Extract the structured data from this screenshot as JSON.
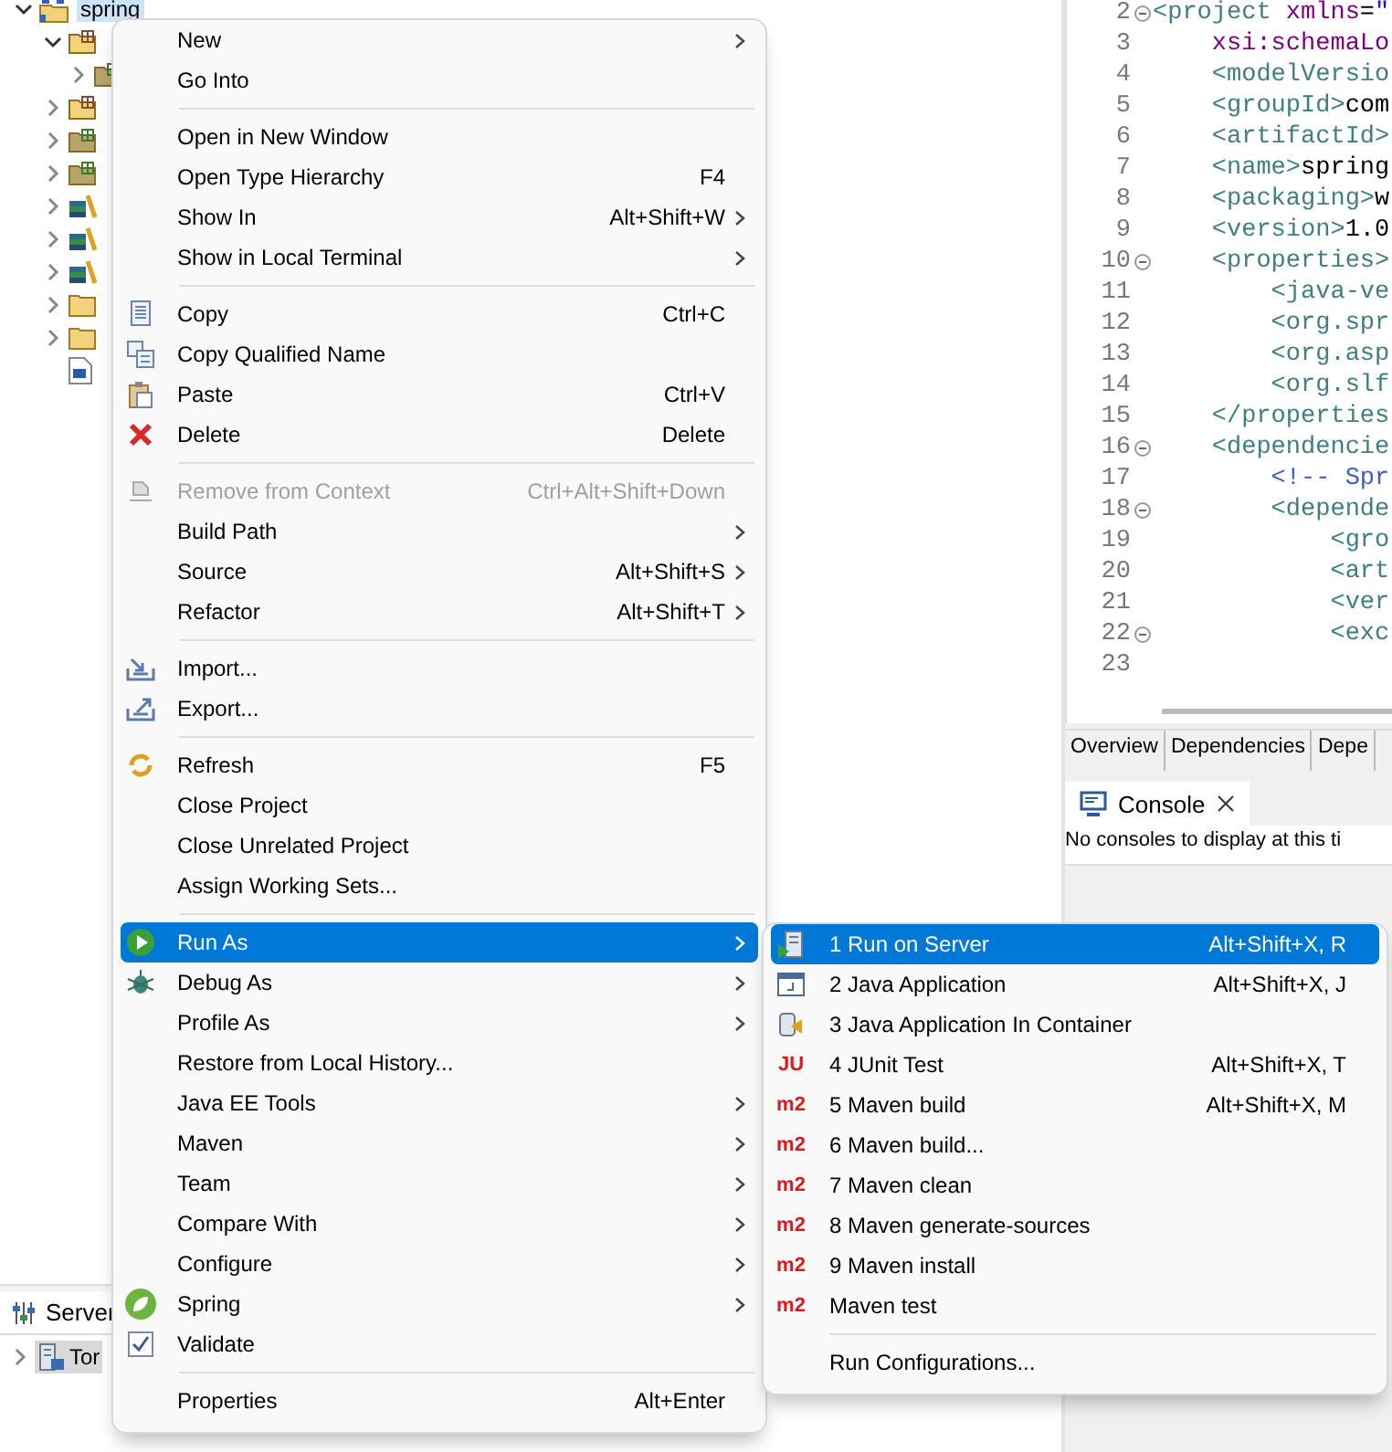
{
  "explorer": {
    "tree": [
      {
        "label": "spring",
        "kind": "project",
        "expanded": true,
        "selected": true,
        "children": [
          {
            "kind": "source",
            "expanded": true,
            "children": [
              {
                "kind": "package",
                "expanded": false
              }
            ]
          },
          {
            "kind": "source",
            "expanded": false
          },
          {
            "kind": "package",
            "expanded": false
          },
          {
            "kind": "package",
            "expanded": false
          },
          {
            "kind": "library",
            "expanded": false
          },
          {
            "kind": "library",
            "expanded": false
          },
          {
            "kind": "library",
            "expanded": false
          },
          {
            "kind": "folder",
            "expanded": false
          },
          {
            "kind": "folder",
            "expanded": false
          },
          {
            "kind": "pom"
          }
        ]
      }
    ]
  },
  "servers": {
    "tab": "Server",
    "rows": [
      {
        "label": "Tor",
        "expanded": false,
        "selected": true
      }
    ]
  },
  "editor": {
    "lines": [
      {
        "number": "2",
        "fold": true,
        "tokens": [
          {
            "kind": "tag",
            "text": "<project"
          },
          {
            "kind": "attr",
            "text": " xmlns"
          },
          {
            "kind": "text",
            "text": "="
          },
          {
            "kind": "value",
            "text": "\""
          }
        ]
      },
      {
        "number": "3",
        "fold": false,
        "tokens": [
          {
            "kind": "attr",
            "text": "    xsi:schemaLo"
          }
        ]
      },
      {
        "number": "4",
        "fold": false,
        "tokens": [
          {
            "kind": "tag",
            "text": "    <modelVersio"
          }
        ]
      },
      {
        "number": "5",
        "fold": false,
        "tokens": [
          {
            "kind": "tag",
            "text": "    <groupId>"
          },
          {
            "kind": "text",
            "text": "com"
          }
        ]
      },
      {
        "number": "6",
        "fold": false,
        "tokens": [
          {
            "kind": "tag",
            "text": "    <artifactId>"
          }
        ]
      },
      {
        "number": "7",
        "fold": false,
        "tokens": [
          {
            "kind": "tag",
            "text": "    <name>"
          },
          {
            "kind": "text",
            "text": "spring"
          }
        ]
      },
      {
        "number": "8",
        "fold": false,
        "tokens": [
          {
            "kind": "tag",
            "text": "    <packaging>"
          },
          {
            "kind": "text",
            "text": "w"
          }
        ]
      },
      {
        "number": "9",
        "fold": false,
        "tokens": [
          {
            "kind": "tag",
            "text": "    <version>"
          },
          {
            "kind": "text",
            "text": "1.0"
          }
        ]
      },
      {
        "number": "10",
        "fold": true,
        "tokens": [
          {
            "kind": "tag",
            "text": "    <properties>"
          }
        ]
      },
      {
        "number": "11",
        "fold": false,
        "tokens": [
          {
            "kind": "tag",
            "text": "        <java-ve"
          }
        ]
      },
      {
        "number": "12",
        "fold": false,
        "tokens": [
          {
            "kind": "tag",
            "text": "        <org.spr"
          }
        ]
      },
      {
        "number": "13",
        "fold": false,
        "tokens": [
          {
            "kind": "tag",
            "text": "        <org.asp"
          }
        ]
      },
      {
        "number": "14",
        "fold": false,
        "tokens": [
          {
            "kind": "tag",
            "text": "        <org.slf"
          }
        ]
      },
      {
        "number": "15",
        "fold": false,
        "tokens": [
          {
            "kind": "tag",
            "text": "    </properties"
          }
        ]
      },
      {
        "number": "16",
        "fold": true,
        "tokens": [
          {
            "kind": "tag",
            "text": "    <dependencie"
          }
        ]
      },
      {
        "number": "17",
        "fold": false,
        "tokens": [
          {
            "kind": "comment",
            "text": "        <!-- Spr"
          }
        ]
      },
      {
        "number": "18",
        "fold": true,
        "tokens": [
          {
            "kind": "tag",
            "text": "        <depende"
          }
        ]
      },
      {
        "number": "19",
        "fold": false,
        "tokens": [
          {
            "kind": "tag",
            "text": "            <gro"
          }
        ]
      },
      {
        "number": "20",
        "fold": false,
        "tokens": [
          {
            "kind": "tag",
            "text": "            <art"
          }
        ]
      },
      {
        "number": "21",
        "fold": false,
        "tokens": [
          {
            "kind": "tag",
            "text": "            <ver"
          }
        ]
      },
      {
        "number": "22",
        "fold": true,
        "tokens": [
          {
            "kind": "tag",
            "text": "            <exc"
          }
        ]
      },
      {
        "number": "23",
        "fold": false
      }
    ],
    "tabs": [
      "Overview",
      "Dependencies",
      "Depe"
    ]
  },
  "console": {
    "tab": "Console",
    "message": "No consoles to display at this ti"
  },
  "context_menu": {
    "groups": [
      {
        "items": [
          {
            "label": "New",
            "kind": "plain",
            "submenu": true,
            "selected": false,
            "disabled": false
          },
          {
            "label": "Go Into",
            "kind": "plain",
            "submenu": false,
            "selected": false,
            "disabled": false
          }
        ]
      },
      {
        "items": [
          {
            "label": "Open in New Window",
            "kind": "plain",
            "submenu": false,
            "selected": false,
            "disabled": false
          },
          {
            "label": "Open Type Hierarchy",
            "shortcut": "F4",
            "kind": "plain",
            "submenu": false,
            "selected": false,
            "disabled": false
          },
          {
            "label": "Show In",
            "shortcut": "Alt+Shift+W",
            "kind": "plain",
            "submenu": true,
            "selected": false,
            "disabled": false
          },
          {
            "label": "Show in Local Terminal",
            "kind": "plain",
            "submenu": true,
            "selected": false,
            "disabled": false
          }
        ]
      },
      {
        "items": [
          {
            "label": "Copy",
            "shortcut": "Ctrl+C",
            "kind": "copy",
            "submenu": false,
            "selected": false,
            "disabled": false
          },
          {
            "label": "Copy Qualified Name",
            "kind": "copyname",
            "submenu": false,
            "selected": false,
            "disabled": false
          },
          {
            "label": "Paste",
            "shortcut": "Ctrl+V",
            "kind": "paste",
            "submenu": false,
            "selected": false,
            "disabled": false
          },
          {
            "label": "Delete",
            "shortcut": "Delete",
            "kind": "delete",
            "submenu": false,
            "selected": false,
            "disabled": false
          }
        ]
      },
      {
        "items": [
          {
            "label": "Remove from Context",
            "shortcut": "Ctrl+Alt+Shift+Down",
            "kind": "remove",
            "submenu": false,
            "selected": false,
            "disabled": true
          },
          {
            "label": "Build Path",
            "kind": "plain",
            "submenu": true,
            "selected": false,
            "disabled": false
          },
          {
            "label": "Source",
            "shortcut": "Alt+Shift+S",
            "kind": "plain",
            "submenu": true,
            "selected": false,
            "disabled": false
          },
          {
            "label": "Refactor",
            "shortcut": "Alt+Shift+T",
            "kind": "plain",
            "submenu": true,
            "selected": false,
            "disabled": false
          }
        ]
      },
      {
        "items": [
          {
            "label": "Import...",
            "kind": "import",
            "submenu": false,
            "selected": false,
            "disabled": false
          },
          {
            "label": "Export...",
            "kind": "export",
            "submenu": false,
            "selected": false,
            "disabled": false
          }
        ]
      },
      {
        "items": [
          {
            "label": "Refresh",
            "shortcut": "F5",
            "kind": "refresh",
            "submenu": false,
            "selected": false,
            "disabled": false
          },
          {
            "label": "Close Project",
            "kind": "plain",
            "submenu": false,
            "selected": false,
            "disabled": false
          },
          {
            "label": "Close Unrelated Project",
            "kind": "plain",
            "submenu": false,
            "selected": false,
            "disabled": false
          },
          {
            "label": "Assign Working Sets...",
            "kind": "plain",
            "submenu": false,
            "selected": false,
            "disabled": false
          }
        ]
      },
      {
        "items": [
          {
            "label": "Run As",
            "kind": "run",
            "submenu": true,
            "selected": true,
            "disabled": false
          },
          {
            "label": "Debug As",
            "kind": "debug",
            "submenu": true,
            "selected": false,
            "disabled": false
          },
          {
            "label": "Profile As",
            "kind": "plain",
            "submenu": true,
            "selected": false,
            "disabled": false
          },
          {
            "label": "Restore from Local History...",
            "kind": "plain",
            "submenu": false,
            "selected": false,
            "disabled": false
          },
          {
            "label": "Java EE Tools",
            "kind": "plain",
            "submenu": true,
            "selected": false,
            "disabled": false
          },
          {
            "label": "Maven",
            "kind": "plain",
            "submenu": true,
            "selected": false,
            "disabled": false
          },
          {
            "label": "Team",
            "kind": "plain",
            "submenu": true,
            "selected": false,
            "disabled": false
          },
          {
            "label": "Compare With",
            "kind": "plain",
            "submenu": true,
            "selected": false,
            "disabled": false
          },
          {
            "label": "Configure",
            "kind": "plain",
            "submenu": true,
            "selected": false,
            "disabled": false
          },
          {
            "label": "Spring",
            "kind": "spring",
            "submenu": true,
            "selected": false,
            "disabled": false
          },
          {
            "label": "Validate",
            "kind": "validate",
            "submenu": false,
            "selected": false,
            "disabled": false
          }
        ]
      },
      {
        "items": [
          {
            "label": "Properties",
            "shortcut": "Alt+Enter",
            "kind": "plain",
            "submenu": false,
            "selected": false,
            "disabled": false
          }
        ]
      }
    ]
  },
  "run_as_menu": {
    "groups": [
      {
        "items": [
          {
            "label": "1 Run on Server",
            "shortcut": "Alt+Shift+X, R",
            "kind": "server",
            "selected": true
          },
          {
            "label": "2 Java Application",
            "shortcut": "Alt+Shift+X, J",
            "kind": "java",
            "selected": false
          },
          {
            "label": "3 Java Application In Container",
            "kind": "container",
            "selected": false
          },
          {
            "label": "4 JUnit Test",
            "shortcut": "Alt+Shift+X, T",
            "kind": "badge",
            "badge": "JU",
            "selected": false
          },
          {
            "label": "5 Maven build",
            "shortcut": "Alt+Shift+X, M",
            "kind": "badge",
            "badge": "m2",
            "selected": false
          },
          {
            "label": "6 Maven build...",
            "kind": "badge",
            "badge": "m2",
            "selected": false
          },
          {
            "label": "7 Maven clean",
            "kind": "badge",
            "badge": "m2",
            "selected": false
          },
          {
            "label": "8 Maven generate-sources",
            "kind": "badge",
            "badge": "m2",
            "selected": false
          },
          {
            "label": "9 Maven install",
            "kind": "badge",
            "badge": "m2",
            "selected": false
          },
          {
            "label": "Maven test",
            "kind": "badge",
            "badge": "m2",
            "selected": false
          }
        ]
      },
      {
        "items": [
          {
            "label": "Run Configurations...",
            "kind": "plain",
            "selected": false
          }
        ]
      }
    ]
  }
}
